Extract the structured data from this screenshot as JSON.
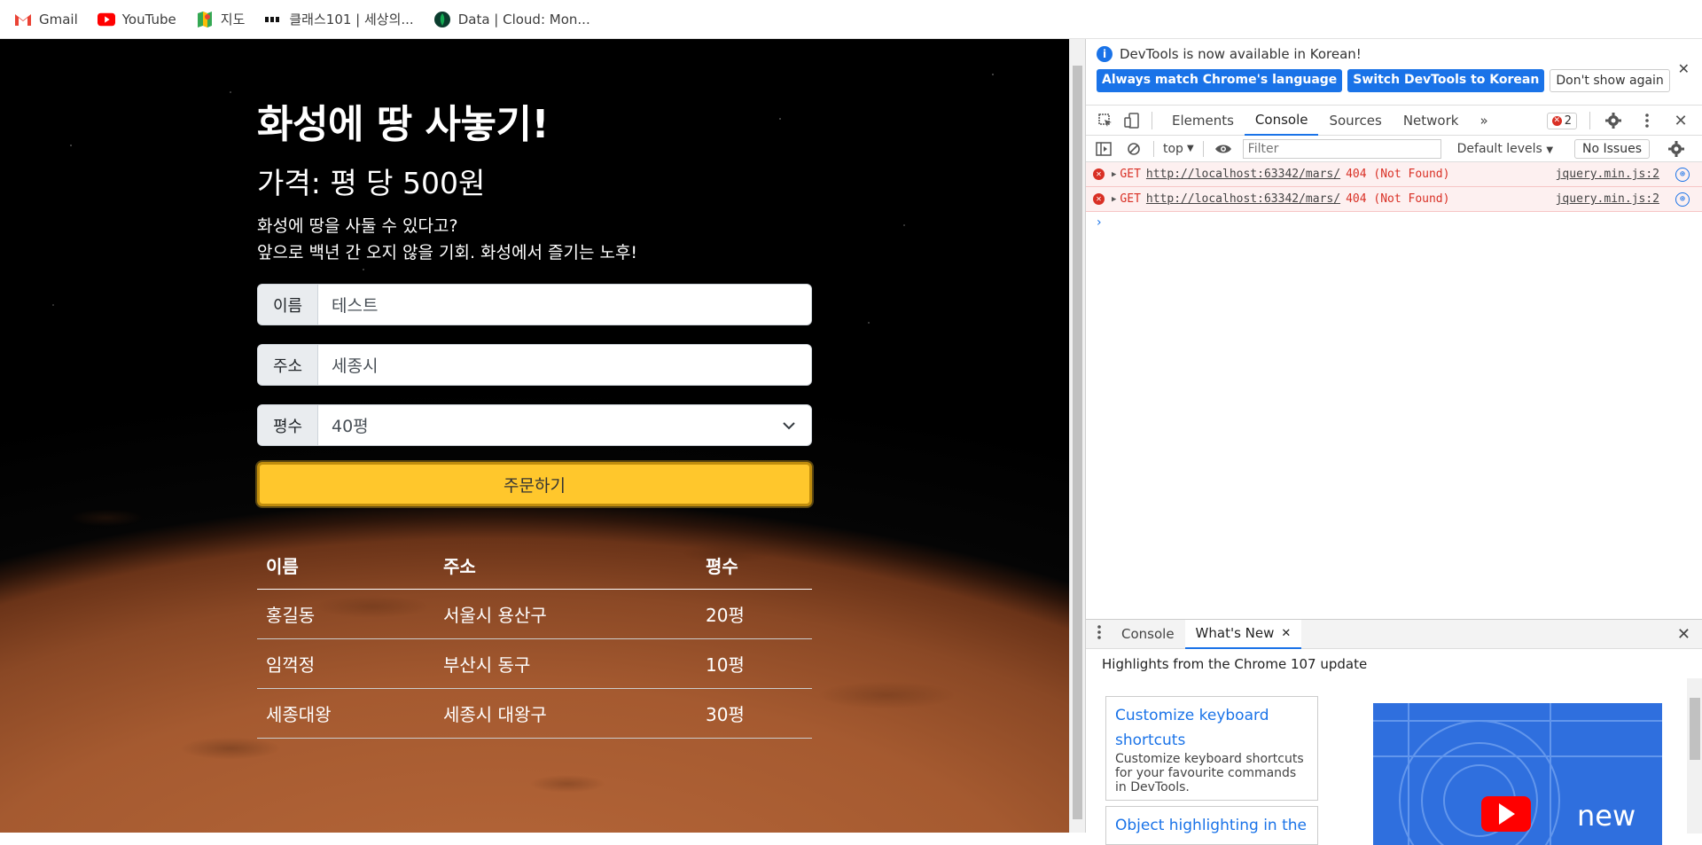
{
  "bookmarks": [
    {
      "label": "Gmail",
      "icon": "gmail-icon"
    },
    {
      "label": "YouTube",
      "icon": "youtube-icon"
    },
    {
      "label": "지도",
      "icon": "maps-icon"
    },
    {
      "label": "클래스101 | 세상의...",
      "icon": "class101-icon"
    },
    {
      "label": "Data | Cloud: Mon...",
      "icon": "mongodb-icon"
    }
  ],
  "page": {
    "title": "화성에 땅 사놓기!",
    "price": "가격: 평 당 500원",
    "desc_line1": "화성에 땅을 사둘 수 있다고?",
    "desc_line2": "앞으로 백년 간 오지 않을 기회. 화성에서 즐기는 노후!",
    "form": {
      "name_label": "이름",
      "name_value": "테스트",
      "address_label": "주소",
      "address_value": "세종시",
      "size_label": "평수",
      "size_value": "40평"
    },
    "order_button": "주문하기",
    "table": {
      "headers": [
        "이름",
        "주소",
        "평수"
      ],
      "rows": [
        [
          "홍길동",
          "서울시 용산구",
          "20평"
        ],
        [
          "임꺽정",
          "부산시 동구",
          "10평"
        ],
        [
          "세종대왕",
          "세종시 대왕구",
          "30평"
        ]
      ]
    }
  },
  "devtools": {
    "info": "DevTools is now available in Korean!",
    "btn_match": "Always match Chrome's language",
    "btn_switch": "Switch DevTools to Korean",
    "btn_dont": "Don't show again",
    "tabs": [
      "Elements",
      "Console",
      "Sources",
      "Network"
    ],
    "active_tab": "Console",
    "more": "»",
    "error_count": "2",
    "context": "top",
    "filter_placeholder": "Filter",
    "levels": "Default levels",
    "issues": "No Issues",
    "logs": [
      {
        "method": "GET",
        "url": "http://localhost:63342/mars/",
        "status": "404 (Not Found)",
        "source": "jquery.min.js:2"
      },
      {
        "method": "GET",
        "url": "http://localhost:63342/mars/",
        "status": "404 (Not Found)",
        "source": "jquery.min.js:2"
      }
    ],
    "prompt": "›",
    "drawer_tabs": [
      "Console",
      "What's New"
    ],
    "drawer_active": "What's New",
    "highlights": "Highlights from the Chrome 107 update",
    "cards": [
      {
        "title_line1": "Customize keyboard",
        "title_line2": "shortcuts",
        "body": "Customize keyboard shortcuts for your favourite commands in DevTools."
      },
      {
        "title_line1": "Object highlighting in the",
        "title_line2": "",
        "body": ""
      }
    ],
    "promo_text": "new"
  },
  "colors": {
    "accent": "#1a73e8",
    "order_button": "#ffc72c",
    "error": "#d93025"
  }
}
